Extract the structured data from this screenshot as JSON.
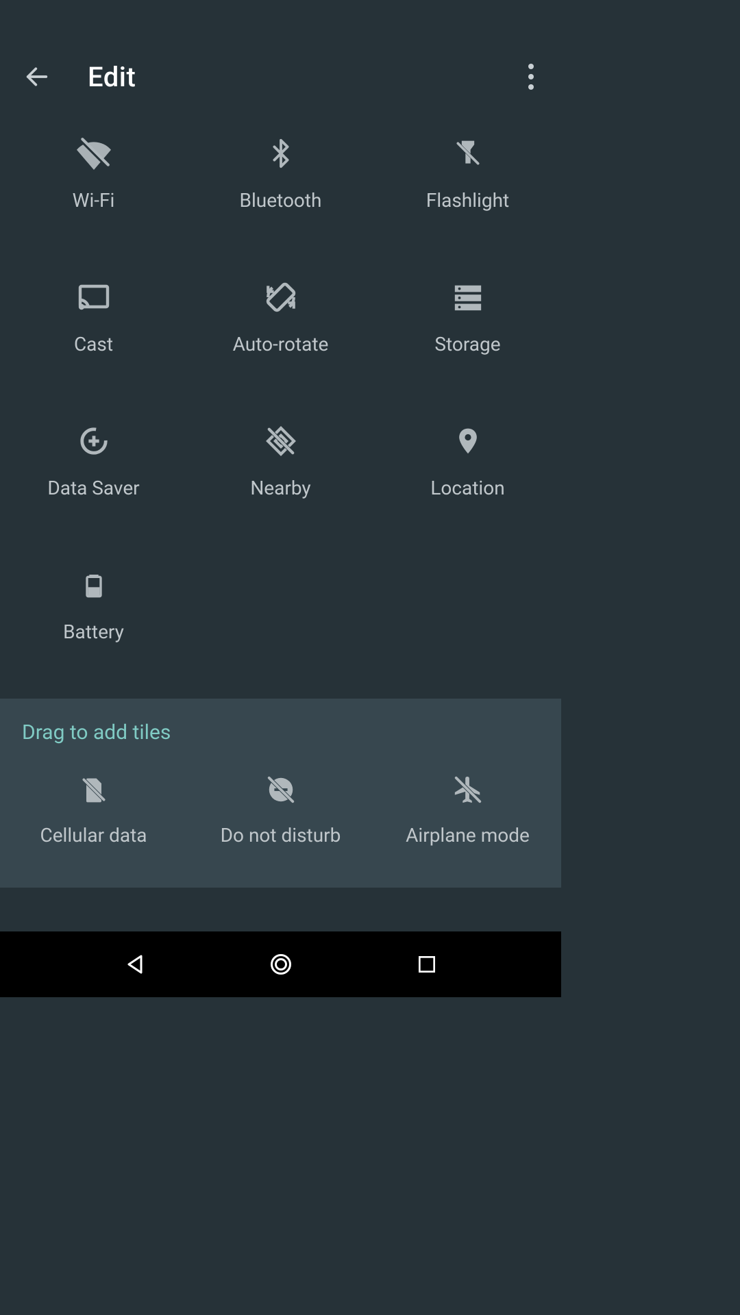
{
  "header": {
    "title": "Edit"
  },
  "tiles": {
    "wifi": "Wi-Fi",
    "bluetooth": "Bluetooth",
    "flashlight": "Flashlight",
    "cast": "Cast",
    "autorotate": "Auto-rotate",
    "storage": "Storage",
    "datasaver": "Data Saver",
    "nearby": "Nearby",
    "location": "Location",
    "battery": "Battery"
  },
  "drag": {
    "title": "Drag to add tiles",
    "cellular": "Cellular data",
    "dnd": "Do not disturb",
    "airplane": "Airplane mode"
  }
}
